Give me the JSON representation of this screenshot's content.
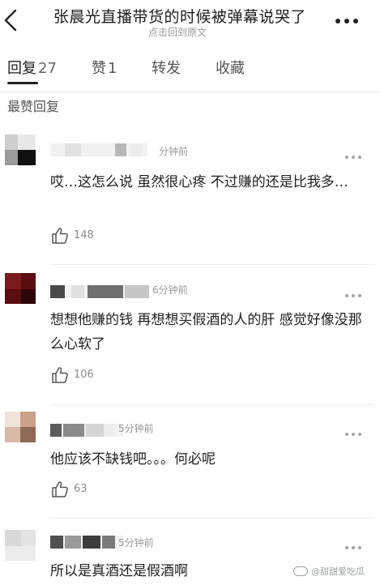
{
  "header": {
    "title": "张晨光直播带货的时候被弹幕说哭了",
    "subtitle": "点击回到原文"
  },
  "tabs": [
    {
      "label": "回复",
      "count": "27"
    },
    {
      "label": "赞",
      "count": "1"
    },
    {
      "label": "转发",
      "count": ""
    },
    {
      "label": "收藏",
      "count": ""
    }
  ],
  "section_title": "最赞回复",
  "comments": [
    {
      "time": "分钟前",
      "text": "哎…这怎么说 虽然很心疼 不过赚的还是比我多…",
      "likes": "148"
    },
    {
      "time": "6分钟前",
      "text": "想想他赚的钱 再想想买假酒的人的肝 感觉好像没那么心软了",
      "likes": "106"
    },
    {
      "time": "5分钟前",
      "text": "他应该不缺钱吧。。。何必呢",
      "likes": "63"
    },
    {
      "time": "5分钟前",
      "text": "所以是真酒还是假酒啊",
      "likes": ""
    }
  ],
  "watermark": "@甜甜爱吃瓜",
  "icons": {
    "back": "chevron-left-icon",
    "more": "ellipsis-icon",
    "like": "thumbs-up-icon",
    "watermark": "weibo-logo-icon"
  }
}
